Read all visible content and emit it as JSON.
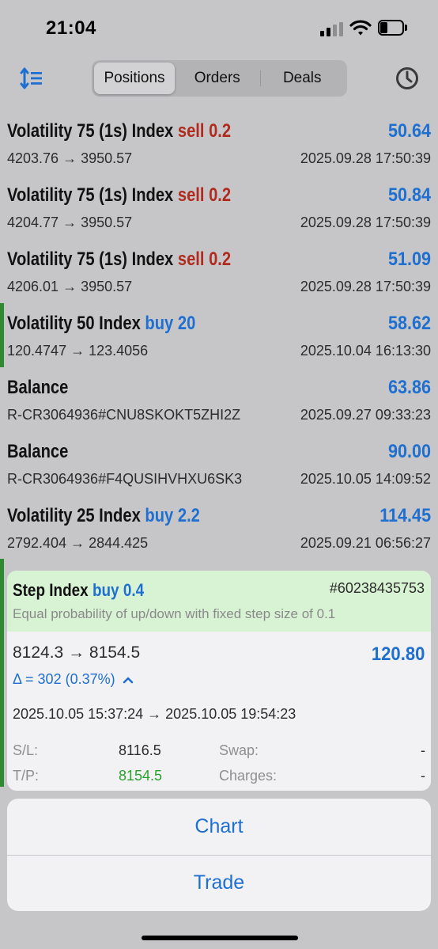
{
  "status_bar": {
    "time": "21:04"
  },
  "header": {
    "sort_icon": "sort-icon",
    "tabs": [
      {
        "label": "Positions",
        "active": true
      },
      {
        "label": "Orders",
        "active": false
      },
      {
        "label": "Deals",
        "active": false
      }
    ],
    "history_icon": "clock-icon"
  },
  "rows": [
    {
      "symbol": "Volatility 75 (1s) Index",
      "type": "sell",
      "volume": "0.2",
      "profit": "50.64",
      "prices": "4203.76 → 3950.57",
      "date": "2025.09.28 17:50:39"
    },
    {
      "symbol": "Volatility 75 (1s) Index",
      "type": "sell",
      "volume": "0.2",
      "profit": "50.84",
      "prices": "4204.77 → 3950.57",
      "date": "2025.09.28 17:50:39"
    },
    {
      "symbol": "Volatility 75 (1s) Index",
      "type": "sell",
      "volume": "0.2",
      "profit": "51.09",
      "prices": "4206.01 → 3950.57",
      "date": "2025.09.28 17:50:39"
    },
    {
      "symbol": "Volatility 50 Index",
      "type": "buy",
      "volume": "20",
      "profit": "58.62",
      "prices": "120.4747 → 123.4056",
      "date": "2025.10.04 16:13:30"
    },
    {
      "symbol": "Balance",
      "type": "",
      "volume": "",
      "profit": "63.86",
      "prices": "R-CR3064936#CNU8SKOKT5ZHI2Z",
      "date": "2025.09.27 09:33:23"
    },
    {
      "symbol": "Balance",
      "type": "",
      "volume": "",
      "profit": "90.00",
      "prices": "R-CR3064936#F4QUSIHVHXU6SK3",
      "date": "2025.10.05 14:09:52"
    },
    {
      "symbol": "Volatility 25 Index",
      "type": "buy",
      "volume": "2.2",
      "profit": "114.45",
      "prices": "2792.404 → 2844.425",
      "date": "2025.09.21 06:56:27"
    }
  ],
  "detail": {
    "symbol": "Step Index",
    "type": "buy",
    "volume": "0.4",
    "ticket": "#60238435753",
    "description": "Equal probability of up/down with fixed step size of 0.1",
    "prices": "8124.3 → 8154.5",
    "profit": "120.80",
    "delta": "Δ = 302 (0.37%)",
    "times": "2025.10.05 15:37:24 → 2025.10.05 19:54:23",
    "sl_label": "S/L:",
    "sl_value": "8116.5",
    "tp_label": "T/P:",
    "tp_value": "8154.5",
    "swap_label": "Swap:",
    "swap_value": "-",
    "charges_label": "Charges:",
    "charges_value": "-"
  },
  "action_sheet": {
    "chart_label": "Chart",
    "trade_label": "Trade"
  },
  "colors": {
    "blue": "#1e6fd0",
    "red": "#b02a1e",
    "green": "#2e8b32",
    "card_header": "#d8f2d4"
  }
}
